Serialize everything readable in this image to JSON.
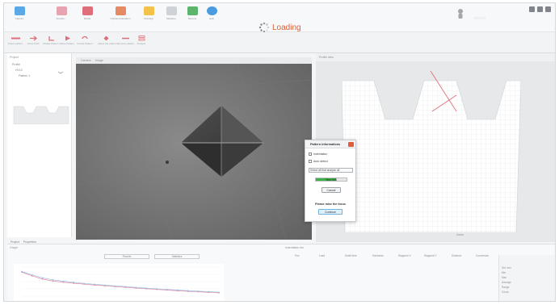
{
  "ribbon": {
    "top_buttons": [
      {
        "label": "Capture",
        "icon": "camera-icon",
        "color": "#5aa9e6"
      },
      {
        "label": "Acquire...",
        "icon": "tray-icon",
        "color": "#e7a3b0"
      },
      {
        "label": "Model",
        "icon": "model-icon",
        "color": "#e06e7a"
      },
      {
        "label": "Optical Indentation",
        "icon": "indent-icon",
        "color": "#e58a62"
      },
      {
        "label": "Overlays",
        "icon": "overlay-icon",
        "color": "#f2c24a"
      },
      {
        "label": "Measure",
        "icon": "measure-icon",
        "color": "#cfd3d7"
      },
      {
        "label": "Reports",
        "icon": "report-icon",
        "color": "#5bb56b"
      },
      {
        "label": "Help",
        "icon": "help-icon",
        "color": "#4a9be0"
      }
    ],
    "sub_buttons": [
      {
        "label": "Indent pattern",
        "icon": "line-icon"
      },
      {
        "label": "Arrow Path",
        "icon": "arrow-icon"
      },
      {
        "label": "Rotate Pattern",
        "icon": "rotate-icon"
      },
      {
        "label": "Move Pattern",
        "icon": "play-icon"
      },
      {
        "label": "Create Pattern",
        "icon": "loop-icon"
      },
      {
        "label": "Indent the pattern",
        "icon": "target-icon"
      },
      {
        "label": "Remove pattern",
        "icon": "dash-icon"
      },
      {
        "label": "Analyse",
        "icon": "stack-icon"
      }
    ],
    "loading_text": "Loading",
    "user_icon": "person-icon",
    "window_controls": [
      "minimize-icon",
      "maximize-icon",
      "close-icon"
    ]
  },
  "left_panel": {
    "title": "Project",
    "items": [
      "Profile",
      "HV10",
      "Pattern 1"
    ]
  },
  "left_tabs": [
    "Project",
    "Properties"
  ],
  "center": {
    "tab_label": "Camera",
    "tab_label_2": "Image"
  },
  "right_panel": {
    "title": "Profile view",
    "footer": "Zoom"
  },
  "dialog": {
    "title": "Pattern informations",
    "indentation_label": "Indentation",
    "auto_detect_label": "Auto detect",
    "select_value": "Select all that analyse all",
    "progress_percent": 0.65,
    "progress_text": "Time 0:05",
    "cancel_label": "Cancel",
    "hint": "Please raise the focus",
    "continue_label": "Continue"
  },
  "bottom": {
    "left_title": "Graph",
    "btn_results": "Results",
    "btn_statistics": "Statistics",
    "table_title": "Indentation list",
    "columns": [
      "Pos",
      "Load",
      "Dwell time",
      "Hardness",
      "Diagonal X",
      "Diagonal Y",
      "Distance",
      "Conversion"
    ],
    "side_info": [
      "Std. dev.",
      "Min",
      "Max",
      "Average",
      "Range",
      "Count"
    ]
  },
  "chart_data": {
    "type": "line",
    "x": [
      1,
      2,
      3,
      4,
      5,
      6,
      7,
      8,
      9,
      10,
      11,
      12,
      13,
      14,
      15,
      16,
      17,
      18,
      19,
      20
    ],
    "series": [
      {
        "values": [
          340,
          310,
          285,
          270,
          260,
          252,
          245,
          238,
          232,
          226,
          220,
          214,
          208,
          203,
          198,
          193,
          188,
          184,
          180,
          176
        ],
        "color": "#e08a9c"
      },
      {
        "values": [
          345,
          318,
          294,
          279,
          268,
          259,
          251,
          244,
          237,
          231,
          225,
          219,
          213,
          208,
          203,
          198,
          193,
          189,
          185,
          181
        ],
        "color": "#9bbce3"
      }
    ],
    "ylim": [
      150,
      380
    ]
  }
}
